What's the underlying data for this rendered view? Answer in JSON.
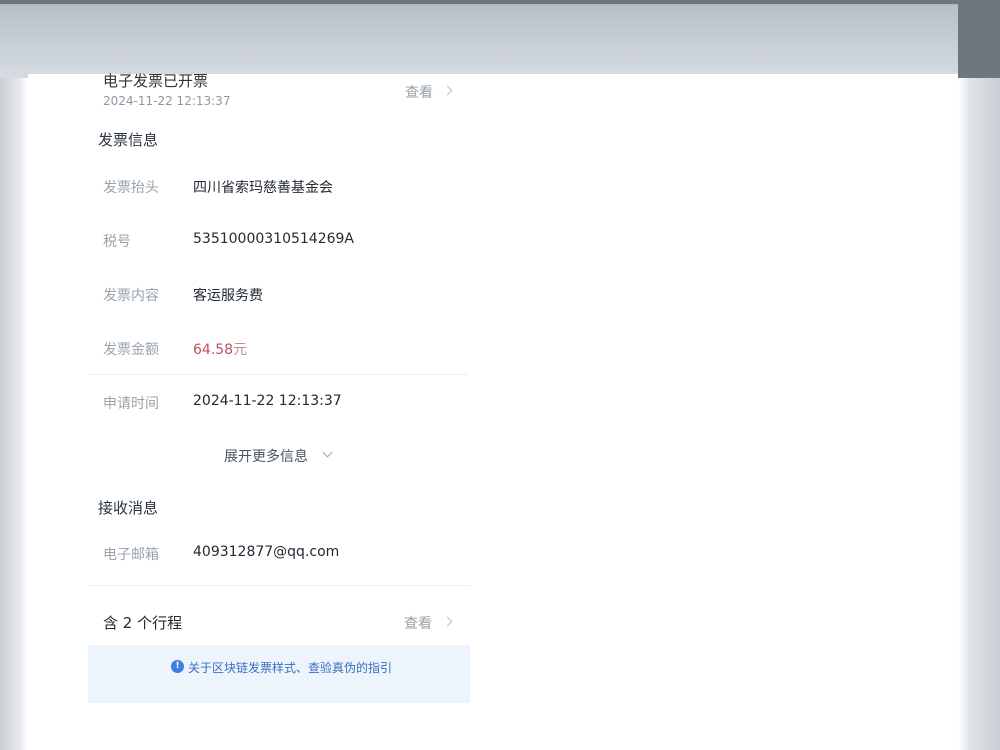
{
  "status": {
    "title": "电子发票已开票",
    "time": "2024-11-22 12:13:37",
    "view_label": "查看"
  },
  "invoice_info": {
    "section_title": "发票信息",
    "fields": [
      {
        "label": "发票抬头",
        "value": "四川省索玛慈善基金会"
      },
      {
        "label": "税号",
        "value": "53510000310514269A"
      },
      {
        "label": "发票内容",
        "value": "客运服务费"
      },
      {
        "label": "发票金额",
        "value": "64.58",
        "unit": "元"
      },
      {
        "label": "申请时间",
        "value": "2024-11-22 12:13:37"
      }
    ],
    "expand_label": "展开更多信息"
  },
  "receive_info": {
    "section_title": "接收消息",
    "email_label": "电子邮箱",
    "email_value": "409312877@qq.com"
  },
  "trips": {
    "title": "含 2 个行程",
    "view_label": "查看"
  },
  "notice": {
    "icon": "info-icon",
    "text": "关于区块链发票样式、查验真伪的指引"
  },
  "colors": {
    "amount": "#c0505f",
    "link": "#3a6fc2",
    "notice_bg": "#edf4fb"
  }
}
